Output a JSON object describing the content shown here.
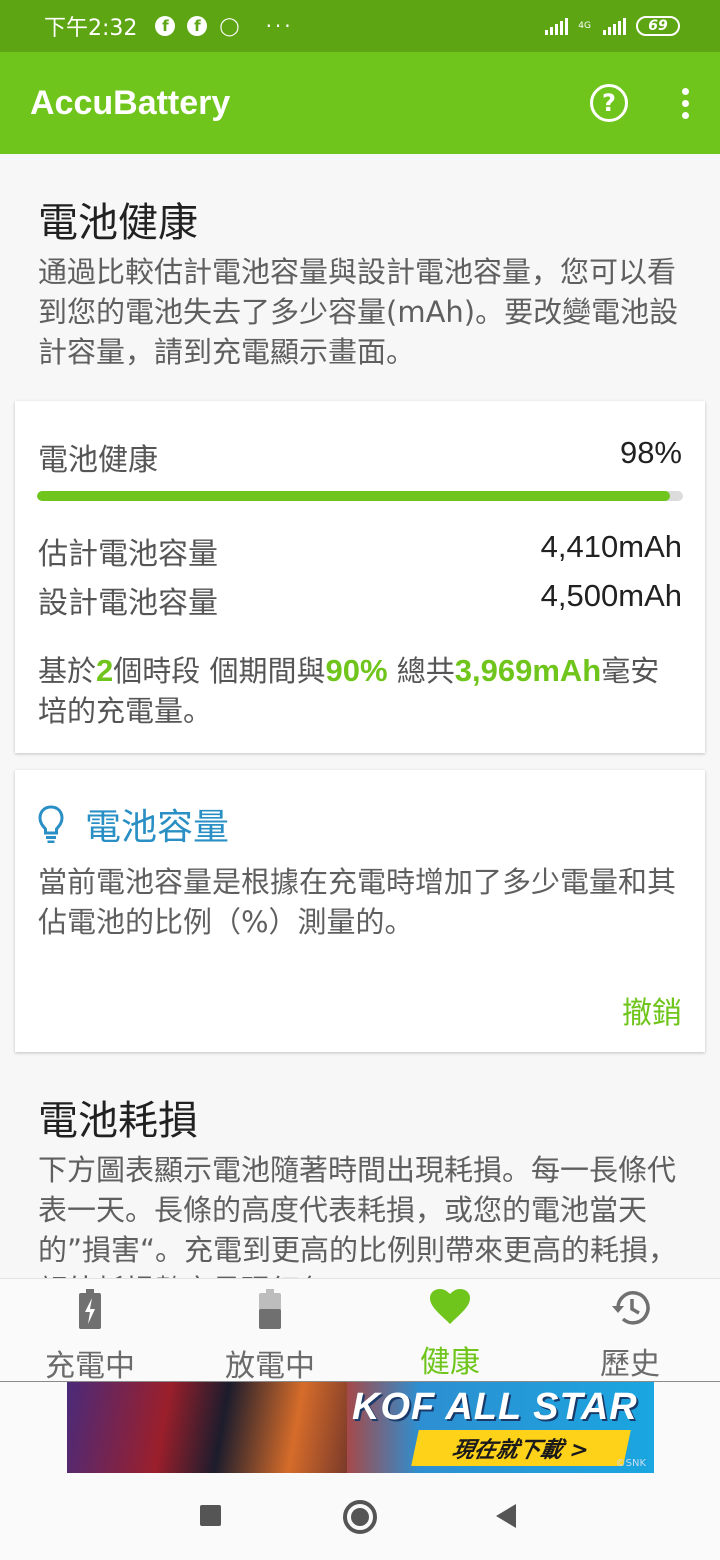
{
  "status_bar": {
    "time": "下午2:32",
    "more": "···",
    "network": "4G",
    "battery_level": "69"
  },
  "app_bar": {
    "title": "AccuBattery"
  },
  "health_section": {
    "title": "電池健康",
    "description": "通過比較估計電池容量與設計電池容量，您可以看到您的電池失去了多少容量(mAh)。要改變電池設計容量，請到充電顯示畫面。"
  },
  "health_card": {
    "health_label": "電池健康",
    "health_value": "98%",
    "health_fraction": 0.98,
    "estimated_label": "估計電池容量",
    "estimated_value": "4,410mAh",
    "design_label": "設計電池容量",
    "design_value": "4,500mAh",
    "summary_prefix": "基於",
    "sessions": "2",
    "summary_mid1": "個時段 個期間與",
    "percent": "90%",
    "summary_mid2": " 總共",
    "total": "3,969mAh",
    "summary_suffix": "毫安培的充電量。"
  },
  "tip_card": {
    "title": "電池容量",
    "description": "當前電池容量是根據在充電時增加了多少電量和其佔電池的比例（%）測量的。",
    "dismiss_label": "撤銷"
  },
  "wear_section": {
    "title": "電池耗損",
    "description": "下方圖表顯示電池隨著時間出現耗損。每一長條代表一天。長條的高度代表耗損，或您的電池當天的”損害“。充電到更高的比例則帶來更高的耗損，額外耗損數字呈現紅色。"
  },
  "bottom_nav": {
    "items": [
      {
        "label": "充電中",
        "icon": "battery-charging-icon"
      },
      {
        "label": "放電中",
        "icon": "battery-discharging-icon"
      },
      {
        "label": "健康",
        "icon": "heart-icon"
      },
      {
        "label": "歷史",
        "icon": "history-icon"
      }
    ],
    "active_index": 2
  },
  "ad_banner": {
    "headline": "KOF ALL STAR",
    "cta": "現在就下載 >",
    "brand": "©SNK"
  },
  "colors": {
    "status_bar": "#5da512",
    "app_bar": "#6fc51b",
    "accent_green": "#6fc51b",
    "tip_blue": "#2a8fc4"
  }
}
